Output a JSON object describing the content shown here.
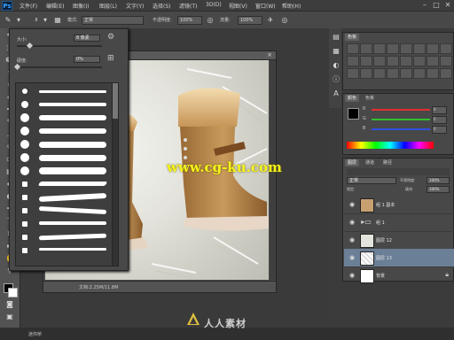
{
  "app": {
    "logo": "Ps"
  },
  "menubar": {
    "items": [
      "文件(F)",
      "编辑(E)",
      "图像(I)",
      "图层(L)",
      "文字(Y)",
      "选择(S)",
      "滤镜(T)",
      "3D(D)",
      "视图(V)",
      "窗口(W)",
      "帮助(H)"
    ],
    "minimize": "–",
    "restore": "□",
    "close": "✕"
  },
  "options": {
    "size_value": "8",
    "mode_label": "模式:",
    "mode_value": "正常",
    "opacity_label": "不透明度:",
    "opacity_value": "100%",
    "flow_label": "流量:",
    "flow_value": "100%"
  },
  "brush_panel": {
    "size_label": "大小:",
    "size_value": "8 像素",
    "hardness_label": "硬度:",
    "hardness_value": "0%",
    "size_slider": 0.15,
    "hardness_slider": 0.0
  },
  "document": {
    "close": "×",
    "status_text": "文档:2.25M/11.8M",
    "watermark": "www.cg-ku.com"
  },
  "panels": {
    "swatches_tab": "色板",
    "color_tabs": [
      "颜色",
      "色板"
    ],
    "color_rows": [
      {
        "label": "R",
        "value": "0",
        "color": "#e03030"
      },
      {
        "label": "G",
        "value": "0",
        "color": "#30c030"
      },
      {
        "label": "B",
        "value": "0",
        "color": "#3050e0"
      }
    ],
    "layers_tabs": [
      "图层",
      "通道",
      "路径"
    ],
    "blend_mode": "正常",
    "opacity_label": "不透明度:",
    "opacity_value": "100%",
    "lock_label": "锁定:",
    "fill_label": "填充:",
    "fill_value": "100%",
    "layers": [
      {
        "name": "组 1 副本",
        "selected": false
      },
      {
        "name": "组 1",
        "selected": false
      },
      {
        "name": "图层 12",
        "selected": false
      },
      {
        "name": "图层 13",
        "selected": true
      },
      {
        "name": "背景",
        "selected": false
      }
    ]
  },
  "statusbar": {
    "text": "迷你桥"
  },
  "watermark_logo": {
    "text": "人人素材"
  },
  "colors": {
    "selected_layer": "#6b7f96",
    "accent": "#38a0ff",
    "watermark_url": "#f5f51a"
  }
}
